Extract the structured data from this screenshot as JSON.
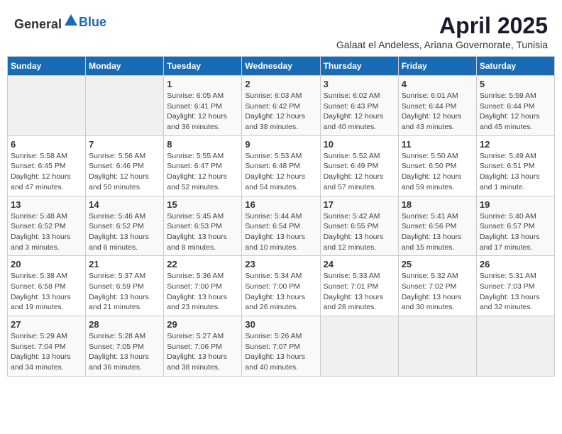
{
  "header": {
    "logo_general": "General",
    "logo_blue": "Blue",
    "month_year": "April 2025",
    "subtitle": "Galaat el Andeless, Ariana Governorate, Tunisia"
  },
  "weekdays": [
    "Sunday",
    "Monday",
    "Tuesday",
    "Wednesday",
    "Thursday",
    "Friday",
    "Saturday"
  ],
  "weeks": [
    [
      {
        "day": null,
        "content": null
      },
      {
        "day": null,
        "content": null
      },
      {
        "day": "1",
        "content": "Sunrise: 6:05 AM\nSunset: 6:41 PM\nDaylight: 12 hours\nand 36 minutes."
      },
      {
        "day": "2",
        "content": "Sunrise: 6:03 AM\nSunset: 6:42 PM\nDaylight: 12 hours\nand 38 minutes."
      },
      {
        "day": "3",
        "content": "Sunrise: 6:02 AM\nSunset: 6:43 PM\nDaylight: 12 hours\nand 40 minutes."
      },
      {
        "day": "4",
        "content": "Sunrise: 6:01 AM\nSunset: 6:44 PM\nDaylight: 12 hours\nand 43 minutes."
      },
      {
        "day": "5",
        "content": "Sunrise: 5:59 AM\nSunset: 6:44 PM\nDaylight: 12 hours\nand 45 minutes."
      }
    ],
    [
      {
        "day": "6",
        "content": "Sunrise: 5:58 AM\nSunset: 6:45 PM\nDaylight: 12 hours\nand 47 minutes."
      },
      {
        "day": "7",
        "content": "Sunrise: 5:56 AM\nSunset: 6:46 PM\nDaylight: 12 hours\nand 50 minutes."
      },
      {
        "day": "8",
        "content": "Sunrise: 5:55 AM\nSunset: 6:47 PM\nDaylight: 12 hours\nand 52 minutes."
      },
      {
        "day": "9",
        "content": "Sunrise: 5:53 AM\nSunset: 6:48 PM\nDaylight: 12 hours\nand 54 minutes."
      },
      {
        "day": "10",
        "content": "Sunrise: 5:52 AM\nSunset: 6:49 PM\nDaylight: 12 hours\nand 57 minutes."
      },
      {
        "day": "11",
        "content": "Sunrise: 5:50 AM\nSunset: 6:50 PM\nDaylight: 12 hours\nand 59 minutes."
      },
      {
        "day": "12",
        "content": "Sunrise: 5:49 AM\nSunset: 6:51 PM\nDaylight: 13 hours\nand 1 minute."
      }
    ],
    [
      {
        "day": "13",
        "content": "Sunrise: 5:48 AM\nSunset: 6:52 PM\nDaylight: 13 hours\nand 3 minutes."
      },
      {
        "day": "14",
        "content": "Sunrise: 5:46 AM\nSunset: 6:52 PM\nDaylight: 13 hours\nand 6 minutes."
      },
      {
        "day": "15",
        "content": "Sunrise: 5:45 AM\nSunset: 6:53 PM\nDaylight: 13 hours\nand 8 minutes."
      },
      {
        "day": "16",
        "content": "Sunrise: 5:44 AM\nSunset: 6:54 PM\nDaylight: 13 hours\nand 10 minutes."
      },
      {
        "day": "17",
        "content": "Sunrise: 5:42 AM\nSunset: 6:55 PM\nDaylight: 13 hours\nand 12 minutes."
      },
      {
        "day": "18",
        "content": "Sunrise: 5:41 AM\nSunset: 6:56 PM\nDaylight: 13 hours\nand 15 minutes."
      },
      {
        "day": "19",
        "content": "Sunrise: 5:40 AM\nSunset: 6:57 PM\nDaylight: 13 hours\nand 17 minutes."
      }
    ],
    [
      {
        "day": "20",
        "content": "Sunrise: 5:38 AM\nSunset: 6:58 PM\nDaylight: 13 hours\nand 19 minutes."
      },
      {
        "day": "21",
        "content": "Sunrise: 5:37 AM\nSunset: 6:59 PM\nDaylight: 13 hours\nand 21 minutes."
      },
      {
        "day": "22",
        "content": "Sunrise: 5:36 AM\nSunset: 7:00 PM\nDaylight: 13 hours\nand 23 minutes."
      },
      {
        "day": "23",
        "content": "Sunrise: 5:34 AM\nSunset: 7:00 PM\nDaylight: 13 hours\nand 26 minutes."
      },
      {
        "day": "24",
        "content": "Sunrise: 5:33 AM\nSunset: 7:01 PM\nDaylight: 13 hours\nand 28 minutes."
      },
      {
        "day": "25",
        "content": "Sunrise: 5:32 AM\nSunset: 7:02 PM\nDaylight: 13 hours\nand 30 minutes."
      },
      {
        "day": "26",
        "content": "Sunrise: 5:31 AM\nSunset: 7:03 PM\nDaylight: 13 hours\nand 32 minutes."
      }
    ],
    [
      {
        "day": "27",
        "content": "Sunrise: 5:29 AM\nSunset: 7:04 PM\nDaylight: 13 hours\nand 34 minutes."
      },
      {
        "day": "28",
        "content": "Sunrise: 5:28 AM\nSunset: 7:05 PM\nDaylight: 13 hours\nand 36 minutes."
      },
      {
        "day": "29",
        "content": "Sunrise: 5:27 AM\nSunset: 7:06 PM\nDaylight: 13 hours\nand 38 minutes."
      },
      {
        "day": "30",
        "content": "Sunrise: 5:26 AM\nSunset: 7:07 PM\nDaylight: 13 hours\nand 40 minutes."
      },
      {
        "day": null,
        "content": null
      },
      {
        "day": null,
        "content": null
      },
      {
        "day": null,
        "content": null
      }
    ]
  ]
}
